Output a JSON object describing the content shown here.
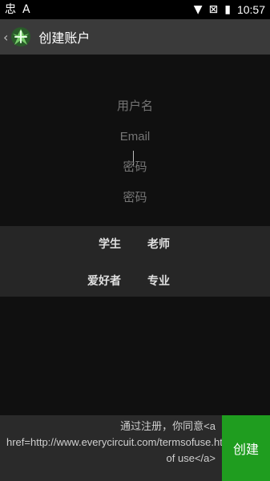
{
  "status_bar": {
    "left_icons": [
      "chinese-char-icon",
      "a-box-icon"
    ],
    "left_glyphs": [
      "忠",
      "A"
    ],
    "right_icons": [
      "wifi-icon",
      "no-sim-icon",
      "battery-icon"
    ],
    "right_glyphs": [
      "▼",
      "⊠",
      "▮"
    ],
    "time": "10:57"
  },
  "action_bar": {
    "title": "创建账户",
    "back_glyph": "‹",
    "logo_icon": "app-logo-icon"
  },
  "form": {
    "username_placeholder": "用户名",
    "email_placeholder": "Email",
    "password_placeholder": "密码",
    "password_confirm_placeholder": "密码"
  },
  "roles": {
    "student": "学生",
    "teacher": "老师",
    "hobbyist": "爱好者",
    "professional": "专业"
  },
  "bottom": {
    "terms_text": "通过注册，你同意<a href=http://www.everycircuit.com/termsofuse.html>Terms of use</a>",
    "create_label": "创建"
  },
  "colors": {
    "accent_green": "#1f9d1f",
    "background": "#101010",
    "action_bar": "#3a3a3a",
    "panel": "#262626"
  }
}
